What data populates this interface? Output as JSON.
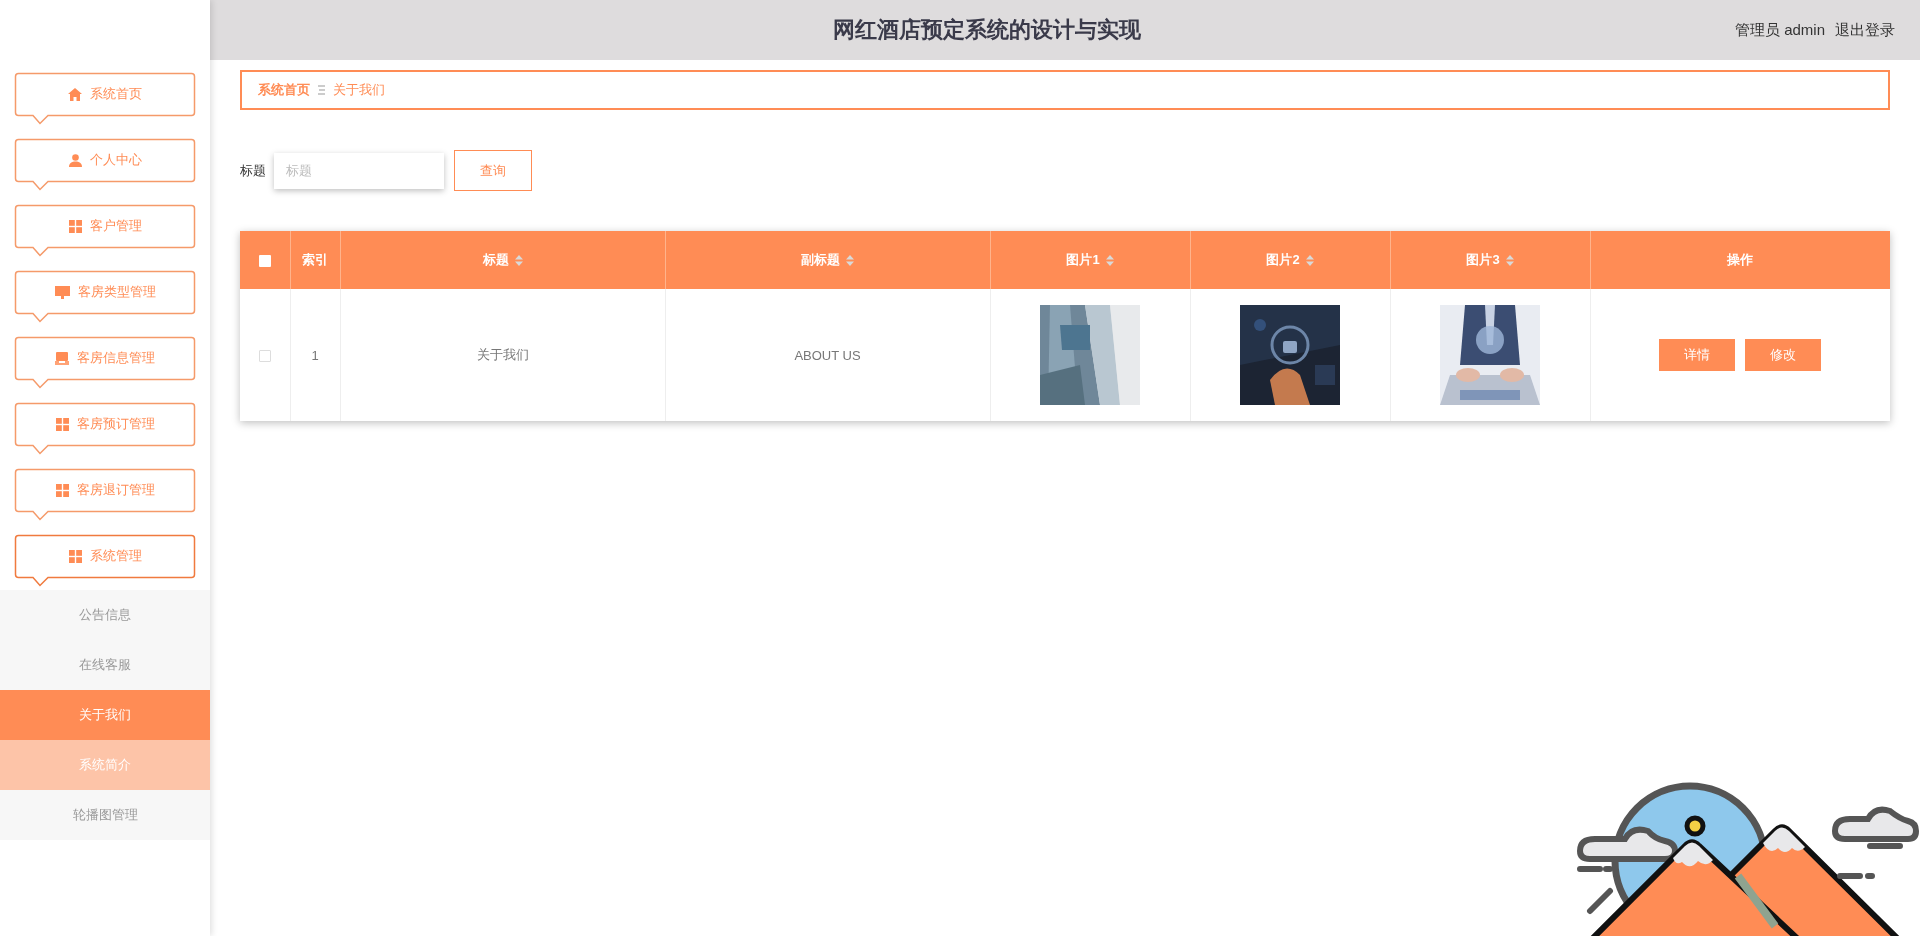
{
  "header": {
    "title": "网红酒店预定系统的设计与实现",
    "user": "管理员 admin",
    "logout": "退出登录"
  },
  "sidebar": {
    "items": [
      {
        "label": "系统首页",
        "expanded": false
      },
      {
        "label": "个人中心",
        "expanded": false
      },
      {
        "label": "客户管理",
        "expanded": false
      },
      {
        "label": "客房类型管理",
        "expanded": false
      },
      {
        "label": "客房信息管理",
        "expanded": false
      },
      {
        "label": "客房预订管理",
        "expanded": false
      },
      {
        "label": "客房退订管理",
        "expanded": false
      },
      {
        "label": "系统管理",
        "expanded": true,
        "children": [
          {
            "label": "公告信息",
            "selected": false,
            "hovered": false
          },
          {
            "label": "在线客服",
            "selected": false,
            "hovered": false
          },
          {
            "label": "关于我们",
            "selected": true,
            "hovered": false
          },
          {
            "label": "系统简介",
            "selected": false,
            "hovered": true
          },
          {
            "label": "轮播图管理",
            "selected": false,
            "hovered": false
          }
        ]
      }
    ]
  },
  "breadcrumb": [
    {
      "label": "系统首页",
      "current": false
    },
    {
      "label": "关于我们",
      "current": true
    }
  ],
  "search": {
    "label": "标题",
    "placeholder": "标题",
    "button": "查询"
  },
  "table": {
    "header_checked": false,
    "columns": [
      {
        "label": "索引",
        "sortable": false
      },
      {
        "label": "标题",
        "sortable": true
      },
      {
        "label": "副标题",
        "sortable": true
      },
      {
        "label": "图片1",
        "sortable": true
      },
      {
        "label": "图片2",
        "sortable": true
      },
      {
        "label": "图片3",
        "sortable": true
      },
      {
        "label": "操作",
        "sortable": false
      }
    ],
    "rows": [
      {
        "checked": false,
        "cells": [
          {
            "kind": "text",
            "text": "1"
          },
          {
            "kind": "text",
            "text": "关于我们"
          },
          {
            "kind": "text",
            "text": "ABOUT US"
          },
          {
            "kind": "picture"
          },
          {
            "kind": "picture"
          },
          {
            "kind": "picture"
          },
          {
            "kind": "actions",
            "buttons": [
              "详情",
              "修改"
            ]
          }
        ]
      }
    ]
  }
}
